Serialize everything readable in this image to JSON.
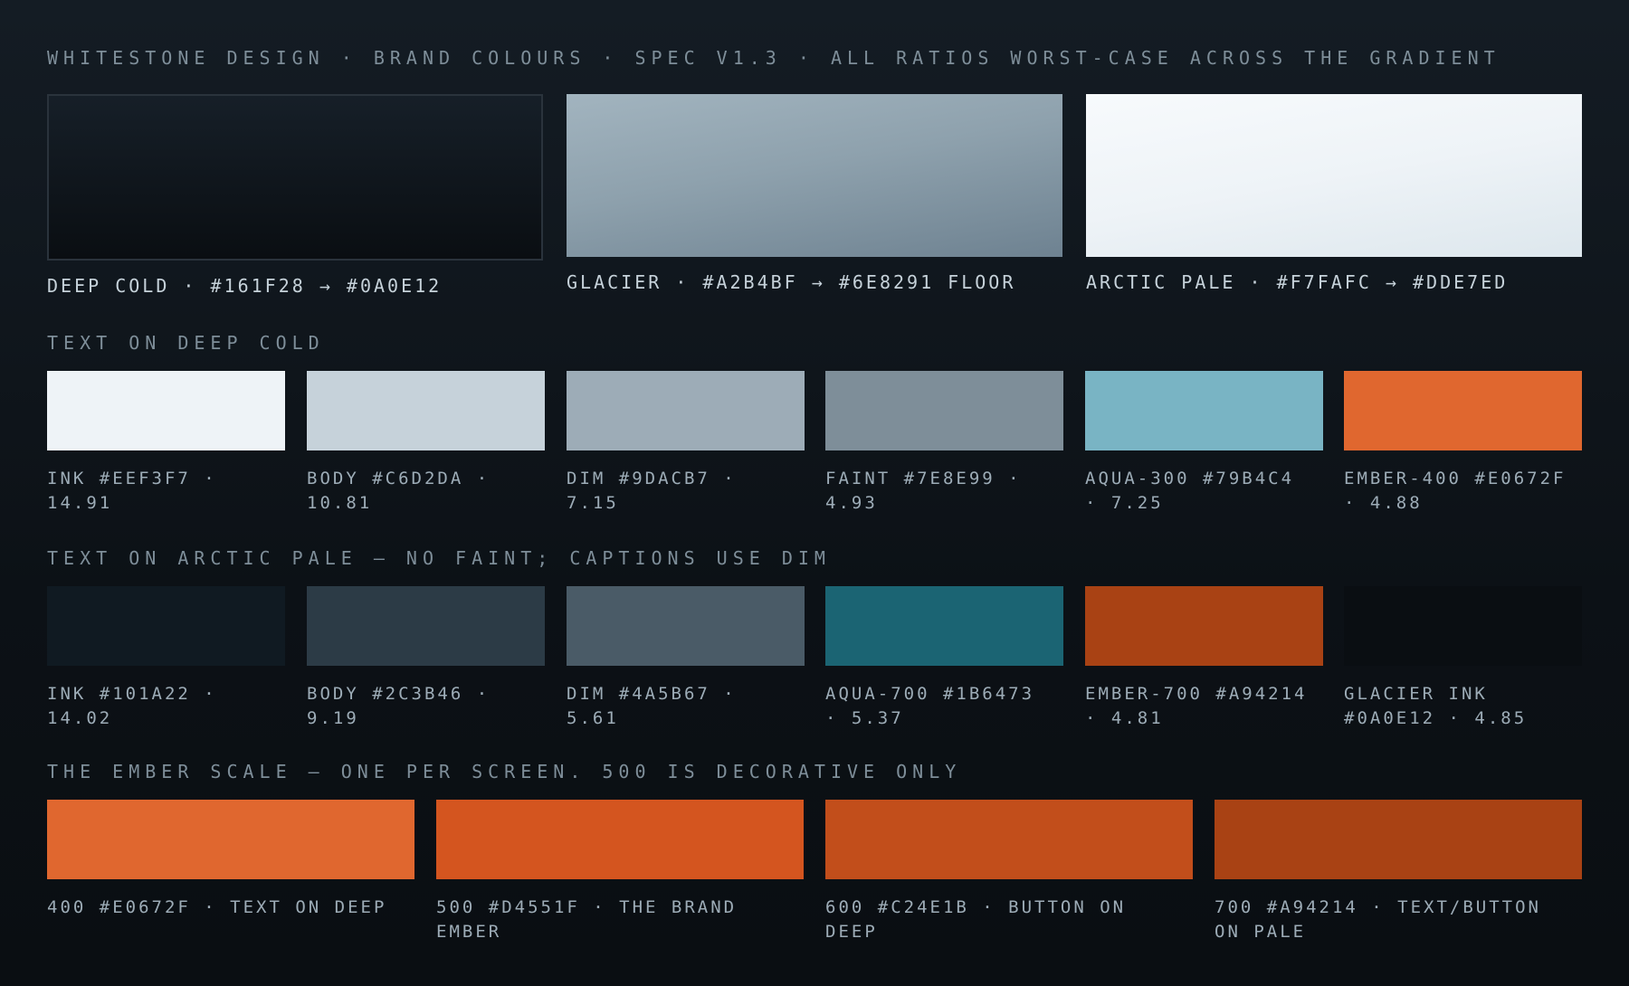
{
  "header": "WHITESTONE DESIGN · BRAND COLOURS · SPEC V1.3 · ALL RATIOS WORST-CASE ACROSS THE GRADIENT",
  "hero": [
    {
      "label": "DEEP COLD · #161F28 → #0A0E12",
      "from": "#161F28",
      "to": "#0A0E12"
    },
    {
      "label": "GLACIER · #A2B4BF → #6E8291 FLOOR",
      "from": "#A2B4BF",
      "to": "#6E8291"
    },
    {
      "label": "ARCTIC PALE · #F7FAFC → #DDE7ED",
      "from": "#F7FAFC",
      "to": "#DDE7ED"
    }
  ],
  "section_deep": {
    "title": "TEXT ON DEEP COLD",
    "items": [
      {
        "label": "INK #EEF3F7 ·\n14.91",
        "color": "#EEF3F7"
      },
      {
        "label": "BODY #C6D2DA ·\n10.81",
        "color": "#C6D2DA"
      },
      {
        "label": "DIM #9DACB7 ·\n7.15",
        "color": "#9DACB7"
      },
      {
        "label": "FAINT #7E8E99 ·\n4.93",
        "color": "#7E8E99"
      },
      {
        "label": "AQUA-300 #79B4C4\n· 7.25",
        "color": "#79B4C4"
      },
      {
        "label": "EMBER-400 #E0672F\n· 4.88",
        "color": "#E0672F"
      }
    ]
  },
  "section_pale": {
    "title": "TEXT ON ARCTIC PALE — NO FAINT; CAPTIONS USE DIM",
    "items": [
      {
        "label": "INK #101A22 ·\n14.02",
        "color": "#101A22"
      },
      {
        "label": "BODY #2C3B46 ·\n9.19",
        "color": "#2C3B46"
      },
      {
        "label": "DIM #4A5B67 ·\n5.61",
        "color": "#4A5B67"
      },
      {
        "label": "AQUA-700 #1B6473\n· 5.37",
        "color": "#1B6473"
      },
      {
        "label": "EMBER-700 #A94214\n· 4.81",
        "color": "#A94214"
      },
      {
        "label": "GLACIER INK\n#0A0E12 · 4.85",
        "color": "#0A0E12"
      }
    ]
  },
  "section_ember": {
    "title": "THE EMBER SCALE — ONE PER SCREEN. 500 IS DECORATIVE ONLY",
    "items": [
      {
        "label": "400 #E0672F · TEXT ON DEEP",
        "color": "#E0672F"
      },
      {
        "label": "500 #D4551F · THE BRAND\nEMBER",
        "color": "#D4551F"
      },
      {
        "label": "600 #C24E1B · BUTTON ON\nDEEP",
        "color": "#C24E1B"
      },
      {
        "label": "700 #A94214 · TEXT/BUTTON\nON PALE",
        "color": "#A94214"
      }
    ]
  }
}
